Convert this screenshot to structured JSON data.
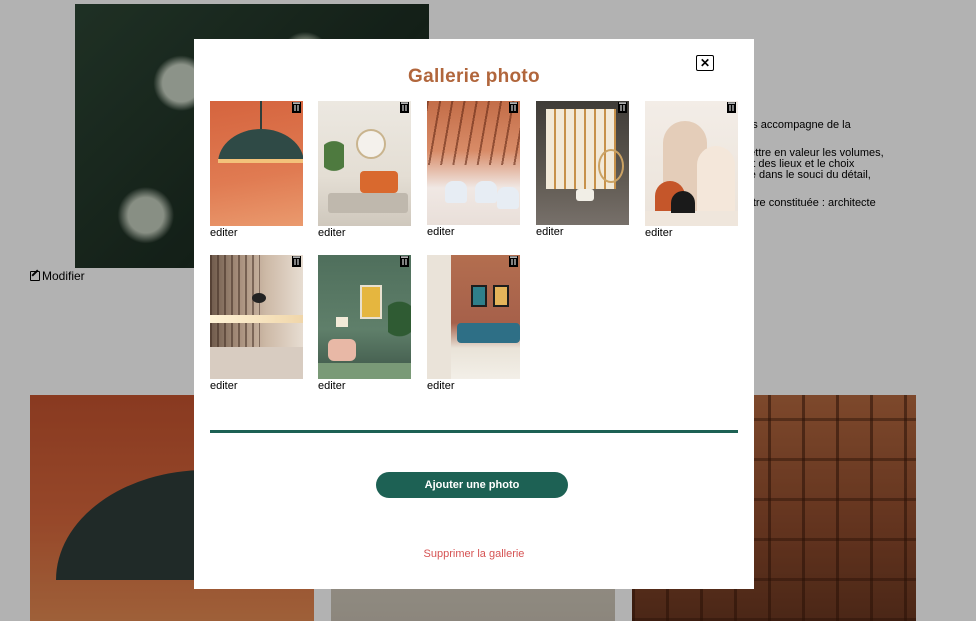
{
  "background": {
    "edit_label": "Modifier",
    "text_lines": [
      "ous accompagne de la",
      "",
      "mettre en valeur les volumes,",
      "prit des lieux et le choix",
      "uré dans le souci du détail,",
      "",
      "",
      "t-être constituée : architecte"
    ]
  },
  "modal": {
    "close_label": "✕",
    "title": "Gallerie photo",
    "edit_label": "editer",
    "photos": [
      {
        "alt": "orange lamp"
      },
      {
        "alt": "living room"
      },
      {
        "alt": "restaurant"
      },
      {
        "alt": "sunny room"
      },
      {
        "alt": "arches"
      },
      {
        "alt": "kitchen"
      },
      {
        "alt": "green room"
      },
      {
        "alt": "bedroom"
      }
    ],
    "add_button_label": "Ajouter une photo",
    "delete_gallery_label": "Supprimer la gallerie"
  },
  "colors": {
    "title": "#b1663c",
    "primary": "#1d6154",
    "danger": "#d65353"
  },
  "icons": {
    "close": "close-icon",
    "trash": "trash-icon",
    "edit": "edit-icon"
  }
}
